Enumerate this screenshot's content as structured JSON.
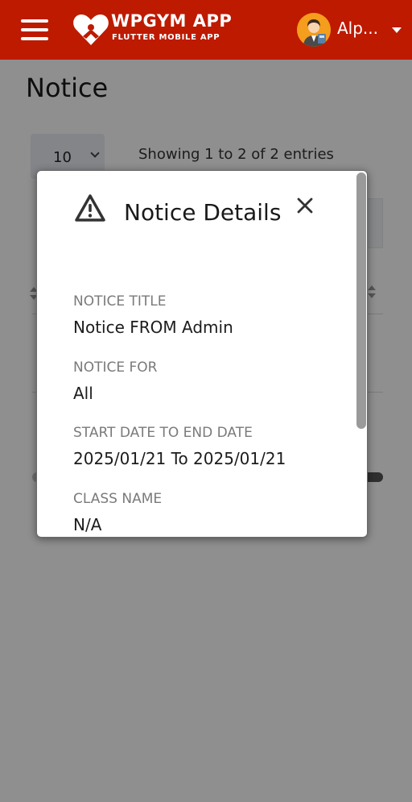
{
  "header": {
    "app_name": "WPGYM APP",
    "app_subtitle": "FLUTTER MOBILE APP",
    "user_name": "Alp...",
    "brand_color": "#bd1a00"
  },
  "page": {
    "title": "Notice",
    "entries_per_page": "10",
    "entries_info": "Showing 1 to 2 of 2 entries"
  },
  "modal": {
    "title": "Notice Details",
    "icon": "warning-triangle-icon",
    "close_icon": "close-icon",
    "fields": [
      {
        "label": "NOTICE TITLE",
        "value": "Notice FROM Admin"
      },
      {
        "label": "NOTICE FOR",
        "value": "All"
      },
      {
        "label": "START DATE TO END DATE",
        "value": "2025/01/21 To 2025/01/21"
      },
      {
        "label": "CLASS NAME",
        "value": "N/A"
      }
    ]
  }
}
